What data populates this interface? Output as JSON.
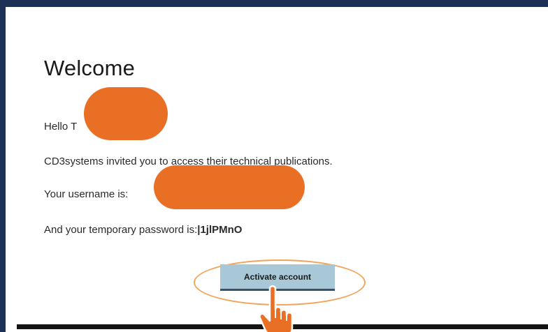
{
  "email": {
    "title": "Welcome",
    "greeting": "Hello T",
    "invite_text": "CD3systems invited you to access their technical publications.",
    "username_label": "Your username is:",
    "password_label": "And your temporary password is:",
    "password_value": "|1jlPMnO",
    "activate_label": "Activate account"
  },
  "colors": {
    "background": "#1d3157",
    "redaction": "#e86f24",
    "button": "#a8c8d8",
    "highlight": "#f1a55a"
  },
  "icons": {
    "cursor": "hand-pointer-icon"
  }
}
